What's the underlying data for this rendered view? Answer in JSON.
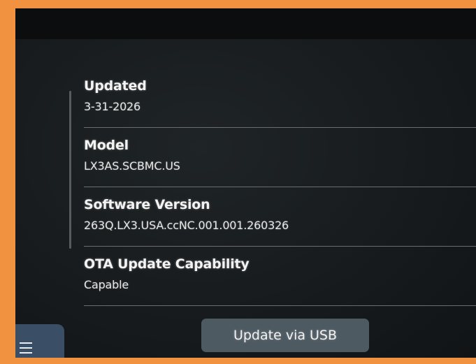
{
  "info_rows": [
    {
      "label": "Updated",
      "value": "3-31-2026"
    },
    {
      "label": "Model",
      "value": "LX3AS.SCBMC.US"
    },
    {
      "label": "Software Version",
      "value": "263Q.LX3.USA.ccNC.001.001.260326"
    },
    {
      "label": "OTA Update Capability",
      "value": "Capable"
    }
  ],
  "actions": {
    "update_usb_label": "Update via USB"
  },
  "icons": {
    "menu": "menu-icon"
  },
  "colors": {
    "frame": "#f0923f",
    "screen_bg": "#171b1d",
    "button_bg": "#4e5a62",
    "menu_bg": "#3a4f66"
  }
}
